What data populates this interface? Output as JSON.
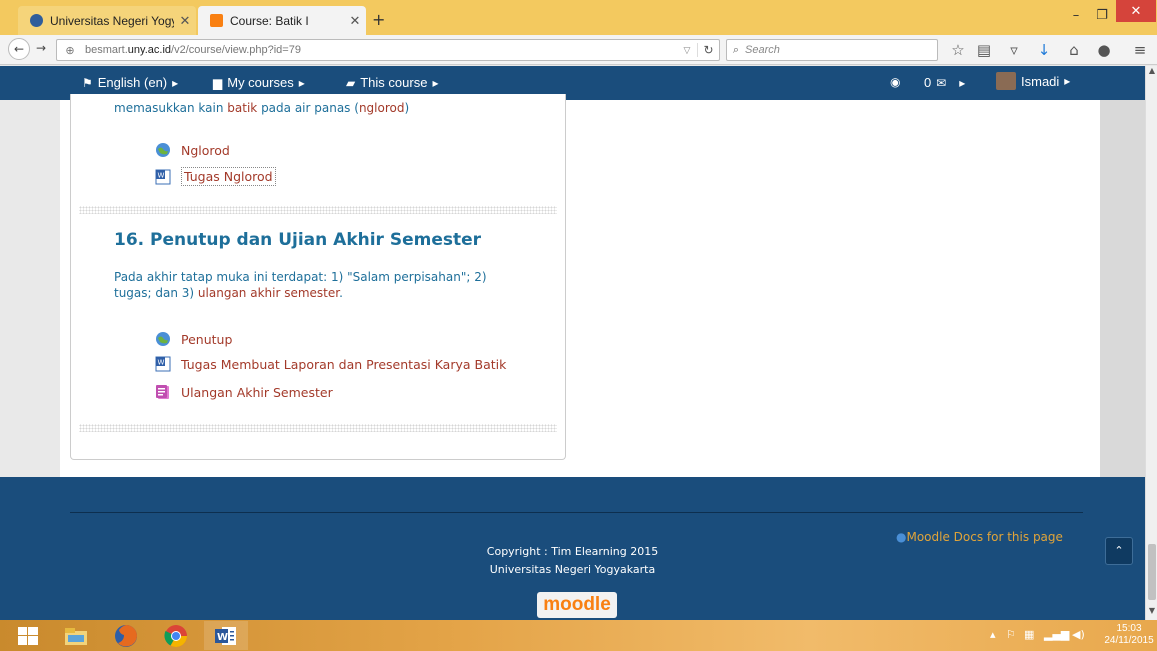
{
  "browser": {
    "tabs": [
      {
        "title": "Universitas Negeri Yogyak...",
        "active": false
      },
      {
        "title": "Course: Batik I",
        "active": true
      }
    ],
    "new_tab": "+",
    "url_prefix": "besmart.",
    "url_domain": "uny.ac.id",
    "url_path": "/v2/course/view.php?id=79",
    "search_placeholder": "Search"
  },
  "moodle_nav": {
    "language": "English (en)",
    "my_courses": "My courses",
    "this_course": "This course",
    "messages_count": "0",
    "user_name": "Ismadi"
  },
  "content": {
    "prev_section_summary_tail": "memasukkan kain ",
    "prev_section_summary_red": "batik",
    "prev_section_summary_rest": " pada air panas (",
    "prev_section_summary_red2": "nglorod",
    "prev_section_summary_end": ")",
    "prev_activities": [
      {
        "label": "Nglorod",
        "icon": "url-icon"
      },
      {
        "label": "Tugas Nglorod",
        "icon": "word-document-icon"
      }
    ],
    "section_title": "16. Penutup dan Ujian Akhir Semester",
    "section_summary_line1": "Pada akhir tatap muka ini terdapat: 1) \"Salam perpisahan\"; 2)",
    "section_summary_line2_a": "tugas; dan 3) ",
    "section_summary_line2_red": "ulangan akhir semester",
    "section_summary_line2_end": ".",
    "activities": [
      {
        "label": "Penutup",
        "icon": "url-icon"
      },
      {
        "label": "Tugas Membuat Laporan dan Presentasi Karya Batik",
        "icon": "word-document-icon"
      },
      {
        "label": "Ulangan Akhir Semester",
        "icon": "quiz-icon"
      }
    ]
  },
  "footer": {
    "copyright": "Copyright : Tim Elearning 2015",
    "university": "Universitas Negeri Yogyakarta",
    "docs_link": "Moodle Docs for this page",
    "logo_text": "moodle"
  },
  "taskbar": {
    "time": "15:03",
    "date": "24/11/2015"
  },
  "colors": {
    "moodle_header": "#1a4d7c",
    "link_red": "#a33a2a",
    "text_blue": "#1e6f9a",
    "tab_bar": "#f3c95f"
  }
}
